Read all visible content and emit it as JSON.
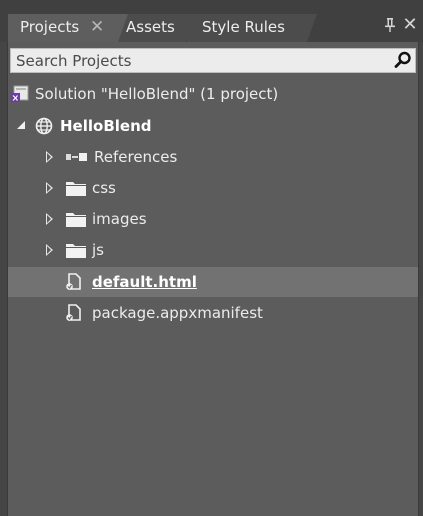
{
  "tabs": [
    {
      "label": "Projects",
      "active": true
    },
    {
      "label": "Assets",
      "active": false
    },
    {
      "label": "Style Rules",
      "active": false
    }
  ],
  "window_controls": {
    "pin_glyph": "ᛘ",
    "close_glyph": "✕"
  },
  "search": {
    "placeholder": "Search Projects",
    "value": ""
  },
  "tree": {
    "solution": "Solution \"HelloBlend\" (1 project)",
    "project": "HelloBlend",
    "items": [
      {
        "label": "References",
        "icon": "references-icon",
        "expandable": true
      },
      {
        "label": "css",
        "icon": "folder-icon",
        "expandable": true
      },
      {
        "label": "images",
        "icon": "folder-icon",
        "expandable": true
      },
      {
        "label": "js",
        "icon": "folder-icon",
        "expandable": true
      },
      {
        "label": "default.html",
        "icon": "file-icon",
        "expandable": false,
        "selected": true
      },
      {
        "label": "package.appxmanifest",
        "icon": "file-icon",
        "expandable": false
      }
    ]
  },
  "colors": {
    "background": "#454545",
    "panel": "#5c5c5c",
    "selected_row": "#727272",
    "active_tab": "#5e5e5e",
    "text": "#ececec"
  }
}
